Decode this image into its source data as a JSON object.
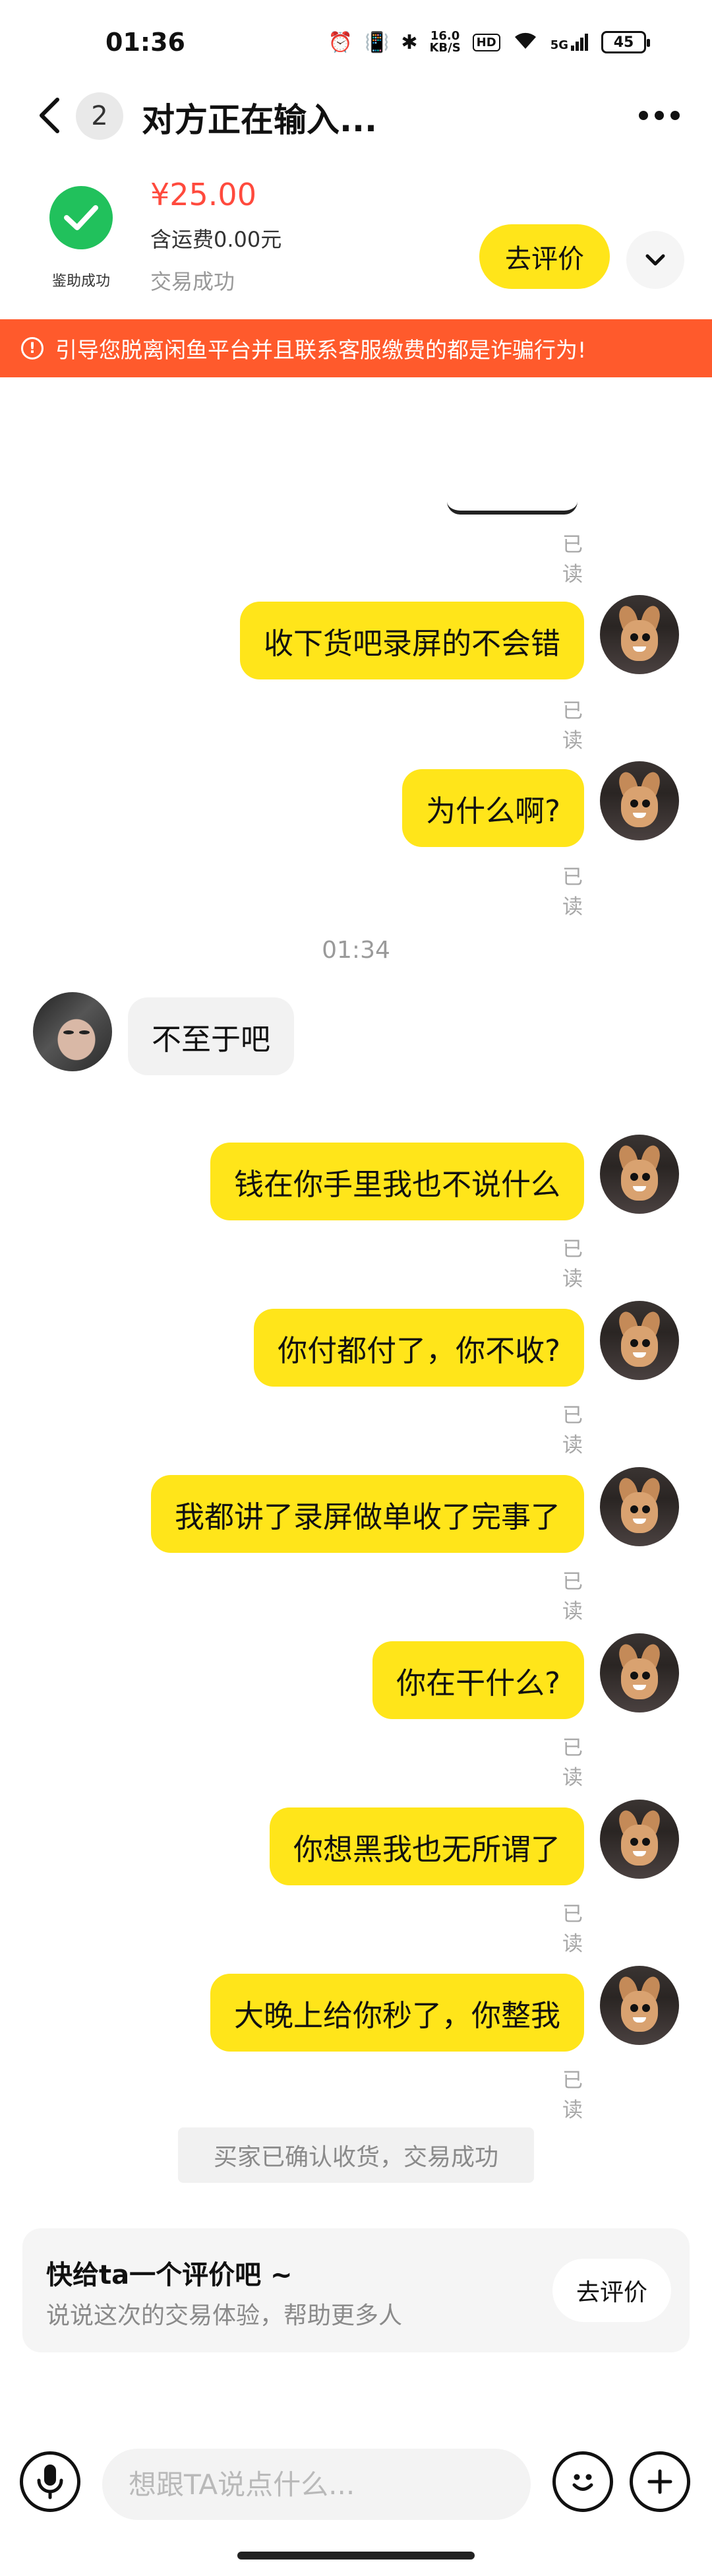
{
  "status_bar": {
    "time": "01:36",
    "net_speed_value": "16.0",
    "net_speed_unit": "KB/S",
    "hd": "HD",
    "signal": "5G",
    "battery": "45"
  },
  "header": {
    "unread_count": "2",
    "title": "对方正在输入..."
  },
  "order": {
    "verified_label": "鉴助成功",
    "price": "¥25.00",
    "shipping": "含运费0.00元",
    "status": "交易成功",
    "review_button": "去评价"
  },
  "warning": {
    "text": "引导您脱离闲鱼平台并且联系客服缴费的都是诈骗行为!"
  },
  "messages_before": [
    {
      "text": "收下货吧录屏的不会错",
      "read": "已读"
    },
    {
      "text": "为什么啊?",
      "read": "已读"
    }
  ],
  "first_read": "已读",
  "time_separator": "01:34",
  "other_message": "不至于吧",
  "messages_after": [
    {
      "text": "钱在你手里我也不说什么",
      "read": "已读"
    },
    {
      "text": "你付都付了，你不收?",
      "read": "已读"
    },
    {
      "text": "我都讲了录屏做单收了完事了",
      "read": "已读"
    },
    {
      "text": "你在干什么?",
      "read": "已读"
    },
    {
      "text": "你想黑我也无所谓了",
      "read": "已读"
    },
    {
      "text": "大晚上给你秒了，你整我",
      "read": "已读"
    }
  ],
  "system_message": "买家已确认收货，交易成功",
  "review_card": {
    "title": "快给ta一个评价吧 ~",
    "subtitle": "说说这次的交易体验，帮助更多人",
    "button": "去评价"
  },
  "input_bar": {
    "placeholder": "想跟TA说点什么..."
  },
  "colors": {
    "accent_yellow": "#ffe51a",
    "warning_orange": "#ff5a2c",
    "price_red": "#ff4a3d",
    "success_green": "#21c15c"
  }
}
